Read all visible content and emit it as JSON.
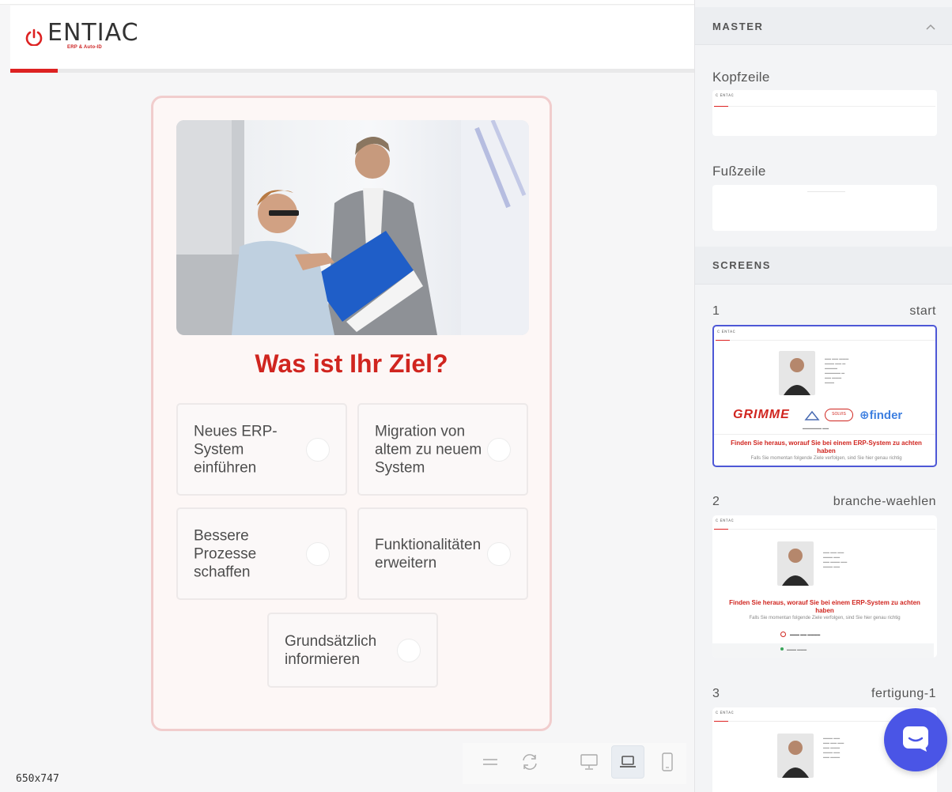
{
  "brand": {
    "wordmark": "ENTIAC",
    "tagline": "ERP & Auto-ID",
    "accent": "#d0251f"
  },
  "question": {
    "title": "Was ist Ihr Ziel?",
    "options": [
      {
        "label": "Neues ERP-System einführen"
      },
      {
        "label": "Migration von altem zu neuem System"
      },
      {
        "label": "Bessere Prozesse schaffen"
      },
      {
        "label": "Funktionalitäten erweitern"
      },
      {
        "label": "Grundsätzlich informieren"
      }
    ]
  },
  "toolbar": {
    "icons": [
      "menu-icon",
      "refresh-icon",
      "desktop-icon",
      "laptop-icon",
      "mobile-icon"
    ],
    "active": "laptop-icon"
  },
  "viewport": {
    "size_label": "650x747"
  },
  "sidebar": {
    "master": {
      "title": "MASTER",
      "header_label": "Kopfzeile",
      "footer_label": "Fußzeile"
    },
    "screens": {
      "title": "SCREENS",
      "items": [
        {
          "number": "1",
          "name": "start"
        },
        {
          "number": "2",
          "name": "branche-waehlen"
        },
        {
          "number": "3",
          "name": "fertigung-1"
        }
      ]
    },
    "thumb": {
      "headline": "Finden Sie heraus, worauf Sie bei einem ERP-System zu achten haben",
      "sub": "Falls Sie momentan folgende Ziele verfolgen, sind Sie hier genau richtig",
      "brands": [
        "GRIMME",
        "SOLVIS",
        "finder"
      ]
    }
  },
  "colors": {
    "selected_border": "#4d57d6",
    "chat": "#4a55e6"
  }
}
